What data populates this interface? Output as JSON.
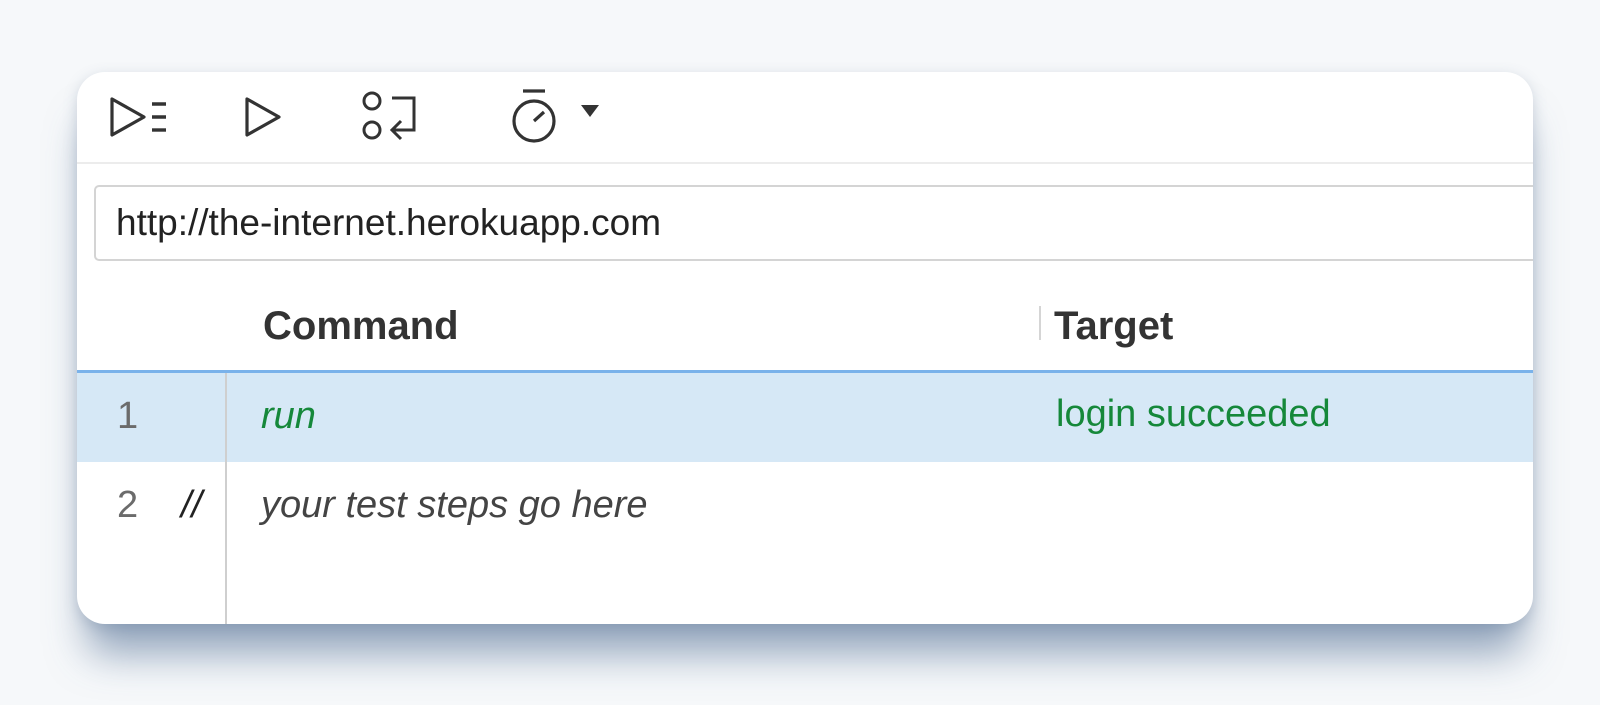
{
  "toolbar": {
    "buttons": [
      {
        "name": "run-all-tests-icon"
      },
      {
        "name": "run-current-test-icon"
      },
      {
        "name": "step-over-icon"
      },
      {
        "name": "test-speed-icon"
      }
    ]
  },
  "url_bar": {
    "value": "http://the-internet.herokuapp.com"
  },
  "table": {
    "columns": [
      "Command",
      "Target"
    ],
    "rows": [
      {
        "num": "1",
        "comment": "",
        "command": "run",
        "target": "login succeeded",
        "selected": true
      },
      {
        "num": "2",
        "comment": "//",
        "command": "your test steps go here",
        "target": "",
        "selected": false
      }
    ]
  },
  "colors": {
    "success": "#15883a",
    "selection": "#d6e8f6",
    "header_underline": "#7ab2ea"
  }
}
